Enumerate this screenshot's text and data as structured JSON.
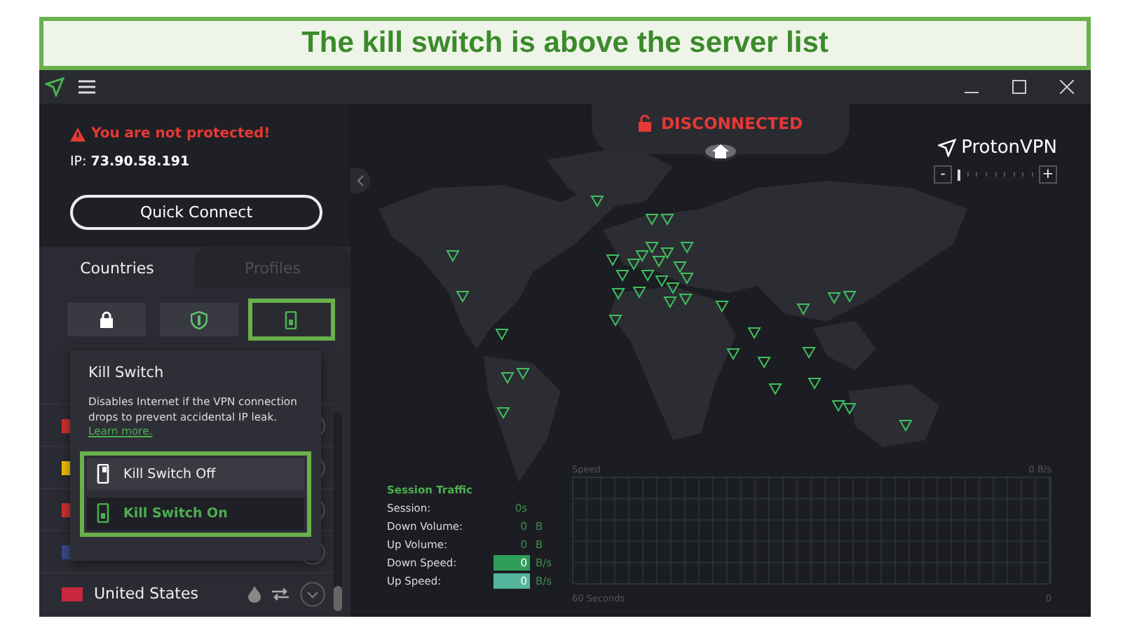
{
  "banner": {
    "text": "The kill switch is above the server list"
  },
  "status": {
    "warning": "You are not protected!",
    "ip_label": "IP:",
    "ip": "73.90.58.191"
  },
  "quick_connect": "Quick Connect",
  "tabs": [
    {
      "label": "Countries",
      "selected": true
    },
    {
      "label": "Profiles",
      "selected": false
    }
  ],
  "toolbar": [
    {
      "kind": "lock",
      "selected": false,
      "highlighted": false
    },
    {
      "kind": "shield",
      "selected": false,
      "highlighted": false
    },
    {
      "kind": "switch",
      "selected": true,
      "highlighted": true
    }
  ],
  "kill_switch_popup": {
    "title": "Kill Switch",
    "description": "Disables Internet if the VPN connection drops to prevent accidental IP leak.",
    "link": "Learn more.",
    "highlighted": true,
    "options": [
      {
        "label": "Kill Switch Off",
        "selected": false
      },
      {
        "label": "Kill Switch On",
        "selected": true
      }
    ]
  },
  "countries": [
    {
      "color": "#d32f2f"
    },
    {
      "color": "#f2c200"
    },
    {
      "color": "#d32f2f"
    },
    {
      "color": "#3a4a8c"
    },
    {
      "name": "United States",
      "color": "#c8283c"
    }
  ],
  "connection": {
    "status": "DISCONNECTED"
  },
  "brand": "ProtonVPN",
  "zoom": {
    "minus": "-",
    "plus": "+",
    "level": 0
  },
  "session_traffic": {
    "title": "Session Traffic",
    "rows": [
      {
        "label": "Session:",
        "value": "0s"
      },
      {
        "label": "Down Volume:",
        "value": "0",
        "unit": "B"
      },
      {
        "label": "Up Volume:",
        "value": "0",
        "unit": "B"
      },
      {
        "label": "Down Speed:",
        "value": "0",
        "unit": "B/s",
        "color": "#2f9e5a"
      },
      {
        "label": "Up Speed:",
        "value": "0",
        "unit": "B/s",
        "color": "#55b59c"
      }
    ]
  },
  "speed_graph": {
    "title": "Speed",
    "max": "0 B/s",
    "x_label": "60 Seconds",
    "min": "0"
  }
}
